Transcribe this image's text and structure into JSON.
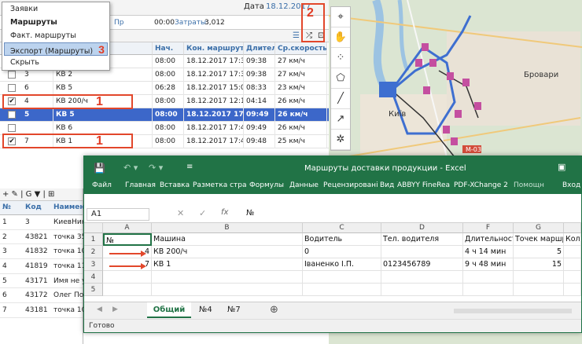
{
  "menu": {
    "items": [
      "Заявки",
      "Маршруты",
      "Факт. маршруты",
      "Экспорт (Маршруты)",
      "Скрыть"
    ]
  },
  "info": {
    "date_label": "Дата",
    "date_value": "18.12.2017",
    "prostoy": "Пр",
    "prostoy_value": "00:00",
    "costs_label": "Затраты:",
    "costs_value": "3,012"
  },
  "badges": {
    "one": "1",
    "two": "2",
    "three": "3"
  },
  "route_table": {
    "headers": [
      "Нач.",
      "Кон. маршрута",
      "Длител",
      "Ср.скорость"
    ],
    "rows": [
      {
        "num": "",
        "name": "",
        "start": "08:00",
        "end": "18.12.2017 17:38",
        "dur": "09:38",
        "speed": "27 км/ч",
        "checked": false
      },
      {
        "num": "3",
        "name": "КВ 2",
        "start": "08:00",
        "end": "18.12.2017 17:38",
        "dur": "09:38",
        "speed": "27 км/ч",
        "checked": false
      },
      {
        "num": "6",
        "name": "КВ 5",
        "start": "06:28",
        "end": "18.12.2017 15:01",
        "dur": "08:33",
        "speed": "23 км/ч",
        "checked": false
      },
      {
        "num": "4",
        "name": "КВ 200/ч",
        "start": "08:00",
        "end": "18.12.2017 12:14",
        "dur": "04:14",
        "speed": "26 км/ч",
        "checked": true
      },
      {
        "num": "5",
        "name": "КВ 5",
        "start": "08:00",
        "end": "18.12.2017 17:49",
        "dur": "09:49",
        "speed": "26 км/ч",
        "checked": false
      },
      {
        "num": "",
        "name": "КВ 6",
        "start": "08:00",
        "end": "18.12.2017 17:49",
        "dur": "09:49",
        "speed": "26 км/ч",
        "checked": false
      },
      {
        "num": "7",
        "name": "КВ 1",
        "start": "08:00",
        "end": "18.12.2017 17:48",
        "dur": "09:48",
        "speed": "25 км/ч",
        "checked": true
      }
    ]
  },
  "lower_grid": {
    "toolbar": "+ ✎ | G ▼ | ⊞",
    "headers": [
      "№",
      "Код",
      "Наимен"
    ],
    "rows": [
      [
        "1",
        "3",
        "КиевНин"
      ],
      [
        "2",
        "43821",
        "точка 358"
      ],
      [
        "3",
        "41832",
        "точка 106"
      ],
      [
        "4",
        "41819",
        "точка 111"
      ],
      [
        "5",
        "43171",
        "Имя не у"
      ],
      [
        "6",
        "43172",
        "Олег Поз"
      ],
      [
        "7",
        "43181",
        "точка 10"
      ]
    ]
  },
  "map_labels": {
    "city": "Київ",
    "brovary": "Бровари",
    "road": "М-03"
  },
  "excel": {
    "title": "Маршруты доставки продукции - Excel",
    "ribbon": [
      "Файл",
      "Главная",
      "Вставка",
      "Разметка стра",
      "Формулы",
      "Данные",
      "Рецензировані",
      "Вид",
      "ABBYY FineRea",
      "PDF-XChange 2",
      "Помощн",
      "Вход"
    ],
    "name_box": "A1",
    "formula": "№",
    "columns": [
      "A",
      "B",
      "C",
      "D",
      "F",
      "G"
    ],
    "row_numbers": [
      "1",
      "2",
      "3",
      "4",
      "5"
    ],
    "header_row": [
      "№",
      "Машина",
      "Водитель",
      "Тел. водителя",
      "Длительност",
      "Точек маршр",
      "Кол-"
    ],
    "rows": [
      [
        "4",
        "КВ 200/ч",
        "0",
        "",
        "4 ч 14 мин",
        "5"
      ],
      [
        "7",
        "КВ 1",
        "Іваненко І.П.",
        "0123456789",
        "9 ч 48 мин",
        "15"
      ]
    ],
    "sheets": [
      "Общий",
      "№4",
      "№7"
    ],
    "status": "Готово"
  },
  "colors": {
    "accent": "#217346",
    "highlight": "#3c67c9",
    "annotation": "#e2472b",
    "link": "#3a6ea8"
  }
}
